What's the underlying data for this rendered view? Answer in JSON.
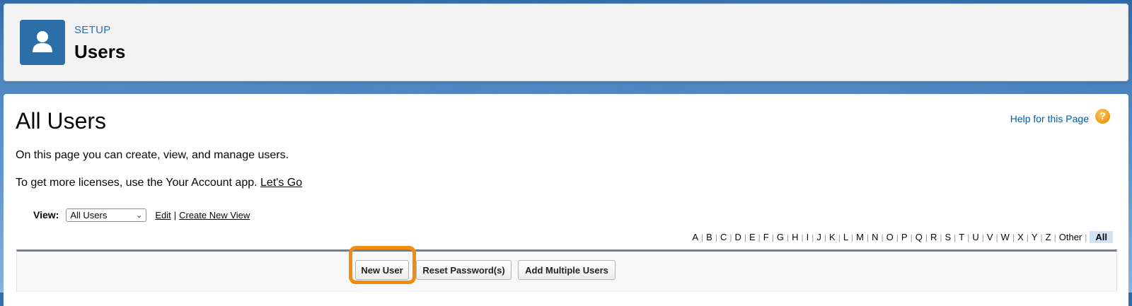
{
  "header": {
    "eyebrow": "SETUP",
    "title": "Users",
    "icon": "user-icon",
    "icon_bg": "#2b6ea8"
  },
  "main": {
    "title": "All Users",
    "help_link": "Help for this Page",
    "help_icon": "question-icon",
    "description": "On this page you can create, view, and manage users.",
    "licenses_text": "To get more licenses, use the Your Account app.",
    "licenses_link": "Let's Go"
  },
  "view": {
    "label": "View:",
    "selected": "All Users",
    "edit_link": "Edit",
    "separator": "|",
    "create_link": "Create New View"
  },
  "alphabet": {
    "letters": [
      "A",
      "B",
      "C",
      "D",
      "E",
      "F",
      "G",
      "H",
      "I",
      "J",
      "K",
      "L",
      "M",
      "N",
      "O",
      "P",
      "Q",
      "R",
      "S",
      "T",
      "U",
      "V",
      "W",
      "X",
      "Y",
      "Z",
      "Other"
    ],
    "active": "All"
  },
  "toolbar": {
    "new_user": "New User",
    "reset_password": "Reset Password(s)",
    "add_multiple": "Add Multiple Users",
    "highlight_color": "#f28c0f"
  }
}
